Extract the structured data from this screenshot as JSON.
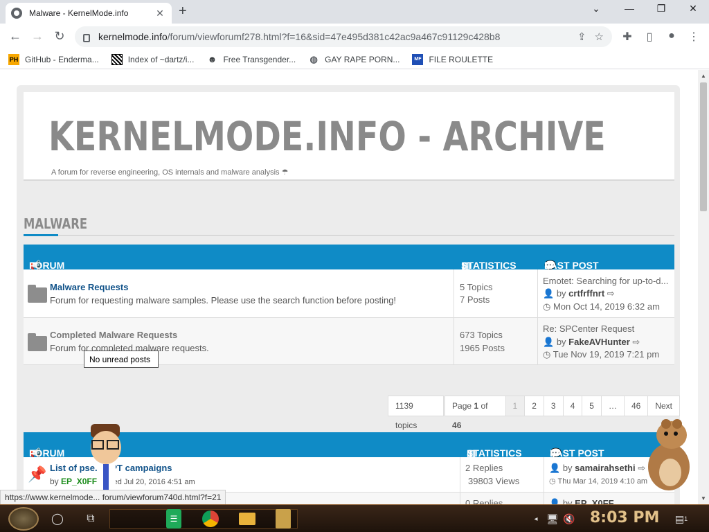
{
  "browser": {
    "tab_title": "Malware - KernelMode.info",
    "new_tab": "+",
    "url_host": "kernelmode.info",
    "url_path": "/forum/viewforumf278.html?f=16&sid=47e495d381c42ac9a467c91129c428b8",
    "bookmarks": [
      {
        "label": "GitHub - Enderma...",
        "icon": "PH"
      },
      {
        "label": "Index of ~dartz/i...",
        "icon": "qr-icon"
      },
      {
        "label": "Free Transgender...",
        "icon": "mask-icon"
      },
      {
        "label": "GAY RAPE PORN...",
        "icon": "globe-icon"
      },
      {
        "label": "FILE ROULETTE",
        "icon": "MF"
      }
    ]
  },
  "site": {
    "title": "KERNELMODE.INFO - ARCHIVE",
    "description": "A forum for reverse engineering, OS internals and malware analysis",
    "section": "MALWARE"
  },
  "forum_table": {
    "headers": {
      "forum": "FORUM",
      "statistics": "STATISTICS",
      "last_post": "LAST POST"
    },
    "rows": [
      {
        "title": "Malware Requests",
        "desc": "Forum for requesting malware samples. Please use the search function before posting!",
        "topics": "5 Topics",
        "posts": "7 Posts",
        "lp_title": "Emotet: Searching for up-to-d...",
        "lp_by": "by",
        "lp_user": "crtfrffnrt",
        "lp_date": "Mon Oct 14, 2019 6:32 am"
      },
      {
        "title": "Completed Malware Requests",
        "desc": "Forum for completed malware requests.",
        "topics": "673 Topics",
        "posts": "1965 Posts",
        "lp_title": "Re: SPCenter Request",
        "lp_by": "by",
        "lp_user": "FakeAVHunter",
        "lp_date": "Tue Nov 19, 2019 7:21 pm"
      }
    ]
  },
  "tooltip": "No unread posts",
  "pagination": {
    "topics": "1139 topics",
    "page_label": "Page",
    "page_cur": "1",
    "page_of": "of",
    "page_total": "46",
    "pages": [
      "1",
      "2",
      "3",
      "4",
      "5",
      "…",
      "46"
    ],
    "next": "Next"
  },
  "topic_table": {
    "headers": {
      "forum": "FORUM",
      "statistics": "STATISTICS",
      "last_post": "LAST POST"
    },
    "rows": [
      {
        "title": "List of pse... APT campaigns",
        "by": "by",
        "author": "EP_X0FF",
        "date": "Wed Jul 20, 2016 4:51 am",
        "replies": "2 Replies",
        "views": "39803 Views",
        "lp_by": "by",
        "lp_user": "samairahsethi",
        "lp_date": "Thu Mar 14, 2019 4:10 am"
      },
      {
        "replies": "0 Replies",
        "lp_by": "by",
        "lp_user": "EP_X0FF"
      }
    ]
  },
  "status_url": "https://www.kernelmode... forum/viewforum740d.html?f=21",
  "taskbar": {
    "clock": "8:03 PM",
    "notif_count": "1"
  },
  "colors": {
    "accent": "#0f8bc6",
    "link": "#105289",
    "title_gray": "#8a8a8a"
  }
}
